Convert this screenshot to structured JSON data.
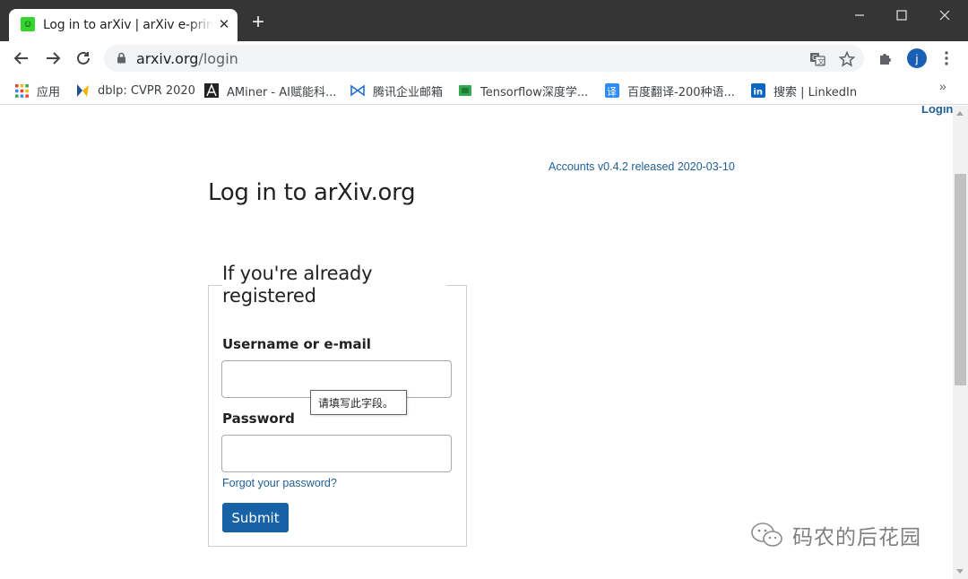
{
  "browser": {
    "tab": {
      "favicon": "smiley-favicon",
      "title": "Log in to arXiv | arXiv e-print r",
      "close_icon": "close-icon"
    },
    "new_tab_icon": "plus-icon",
    "window_controls": [
      "minimize-icon",
      "maximize-icon",
      "close-icon"
    ],
    "address": {
      "host": "arxiv.org",
      "path": "/login"
    },
    "omnibox_icons": [
      "translate-icon",
      "star-icon"
    ],
    "profile_initial": "j",
    "bookmarks": [
      {
        "label": "应用",
        "icon": "apps-grid-icon"
      },
      {
        "label": "dblp: CVPR 2020",
        "icon": "dblp-icon"
      },
      {
        "label": "AMiner - AI赋能科...",
        "icon": "aminer-icon"
      },
      {
        "label": "腾讯企业邮箱",
        "icon": "tencent-mail-icon"
      },
      {
        "label": "Tensorflow深度学...",
        "icon": "tensorflow-icon"
      },
      {
        "label": "百度翻译-200种语...",
        "icon": "baidu-translate-icon"
      },
      {
        "label": "搜索 | LinkedIn",
        "icon": "linkedin-icon"
      }
    ],
    "bookmarks_overflow": "»"
  },
  "page": {
    "login_link": "Login",
    "version": "Accounts v0.4.2 released 2020-03-10",
    "heading": "Log in to arXiv.org",
    "legend": "If you're already registered",
    "username_label": "Username or e-mail",
    "username_value": "",
    "password_label": "Password",
    "password_value": "",
    "forgot_link": "Forgot your password?",
    "submit_label": "Submit",
    "validation_tooltip": "请填写此字段。"
  },
  "watermark": {
    "text": "码农的后花园",
    "icon": "wechat-icon"
  },
  "colors": {
    "titlebar": "#353536",
    "link": "#1f5e96",
    "submit": "#1762a7",
    "profile": "#1a5fb4"
  }
}
